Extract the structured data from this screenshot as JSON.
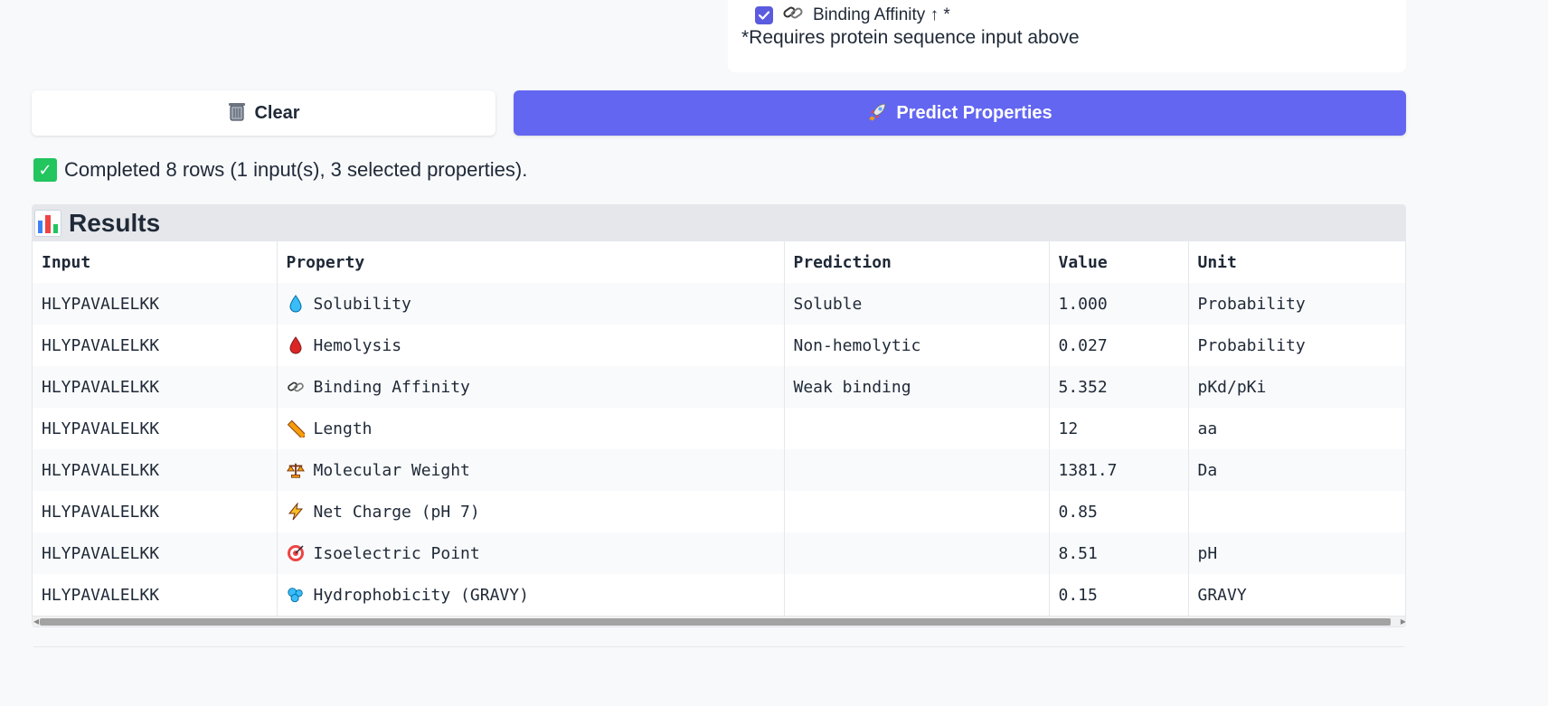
{
  "options": {
    "binding_affinity_label": "Binding Affinity ↑ *",
    "note": "*Requires protein sequence input above"
  },
  "buttons": {
    "clear_label": "Clear",
    "predict_label": "Predict Properties"
  },
  "status": {
    "text": "Completed 8 rows (1 input(s), 3 selected properties)."
  },
  "results": {
    "title": "Results",
    "columns": [
      "Input",
      "Property",
      "Prediction",
      "Value",
      "Unit"
    ],
    "rows": [
      {
        "input": "HLYPAVALELKK",
        "icon": "droplet-icon",
        "property": "Solubility",
        "prediction": "Soluble",
        "value": "1.000",
        "unit": "Probability"
      },
      {
        "input": "HLYPAVALELKK",
        "icon": "blood-drop-icon",
        "property": "Hemolysis",
        "prediction": "Non-hemolytic",
        "value": "0.027",
        "unit": "Probability"
      },
      {
        "input": "HLYPAVALELKK",
        "icon": "link-icon",
        "property": "Binding Affinity",
        "prediction": "Weak binding",
        "value": "5.352",
        "unit": "pKd/pKi"
      },
      {
        "input": "HLYPAVALELKK",
        "icon": "ruler-icon",
        "property": "Length",
        "prediction": "",
        "value": "12",
        "unit": "aa"
      },
      {
        "input": "HLYPAVALELKK",
        "icon": "scales-icon",
        "property": "Molecular Weight",
        "prediction": "",
        "value": "1381.7",
        "unit": "Da"
      },
      {
        "input": "HLYPAVALELKK",
        "icon": "lightning-icon",
        "property": "Net Charge (pH 7)",
        "prediction": "",
        "value": "0.85",
        "unit": ""
      },
      {
        "input": "HLYPAVALELKK",
        "icon": "target-icon",
        "property": "Isoelectric Point",
        "prediction": "",
        "value": "8.51",
        "unit": "pH"
      },
      {
        "input": "HLYPAVALELKK",
        "icon": "bubbles-icon",
        "property": "Hydrophobicity (GRAVY)",
        "prediction": "",
        "value": "0.15",
        "unit": "GRAVY"
      }
    ]
  },
  "colors": {
    "accent": "#6366f1",
    "success": "#22c55e",
    "header_bg": "#e5e7eb"
  }
}
